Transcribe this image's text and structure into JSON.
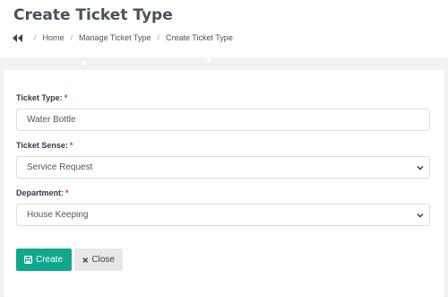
{
  "page": {
    "title": "Create Ticket Type"
  },
  "breadcrumb": {
    "home": "Home",
    "parent": "Manage Ticket Type",
    "current": "Create Ticket Type",
    "separator": "/"
  },
  "form": {
    "ticket_type": {
      "label": "Ticket Type:",
      "required_mark": "*",
      "value": "Water Bottle"
    },
    "ticket_sense": {
      "label": "Ticket Sense:",
      "required_mark": "*",
      "selected": "Service Request"
    },
    "department": {
      "label": "Department:",
      "required_mark": "*",
      "selected": "House Keeping"
    }
  },
  "actions": {
    "create_label": "Create",
    "close_label": "Close"
  },
  "colors": {
    "primary_button": "#0fa88c",
    "secondary_button": "#e7e8ea",
    "required": "#e3343b",
    "title": "#49525b"
  },
  "icons": {
    "breadcrumb_back": "double-chevron-left-icon",
    "create": "save-icon",
    "close": "close-icon",
    "select_arrow": "chevron-down-icon"
  }
}
